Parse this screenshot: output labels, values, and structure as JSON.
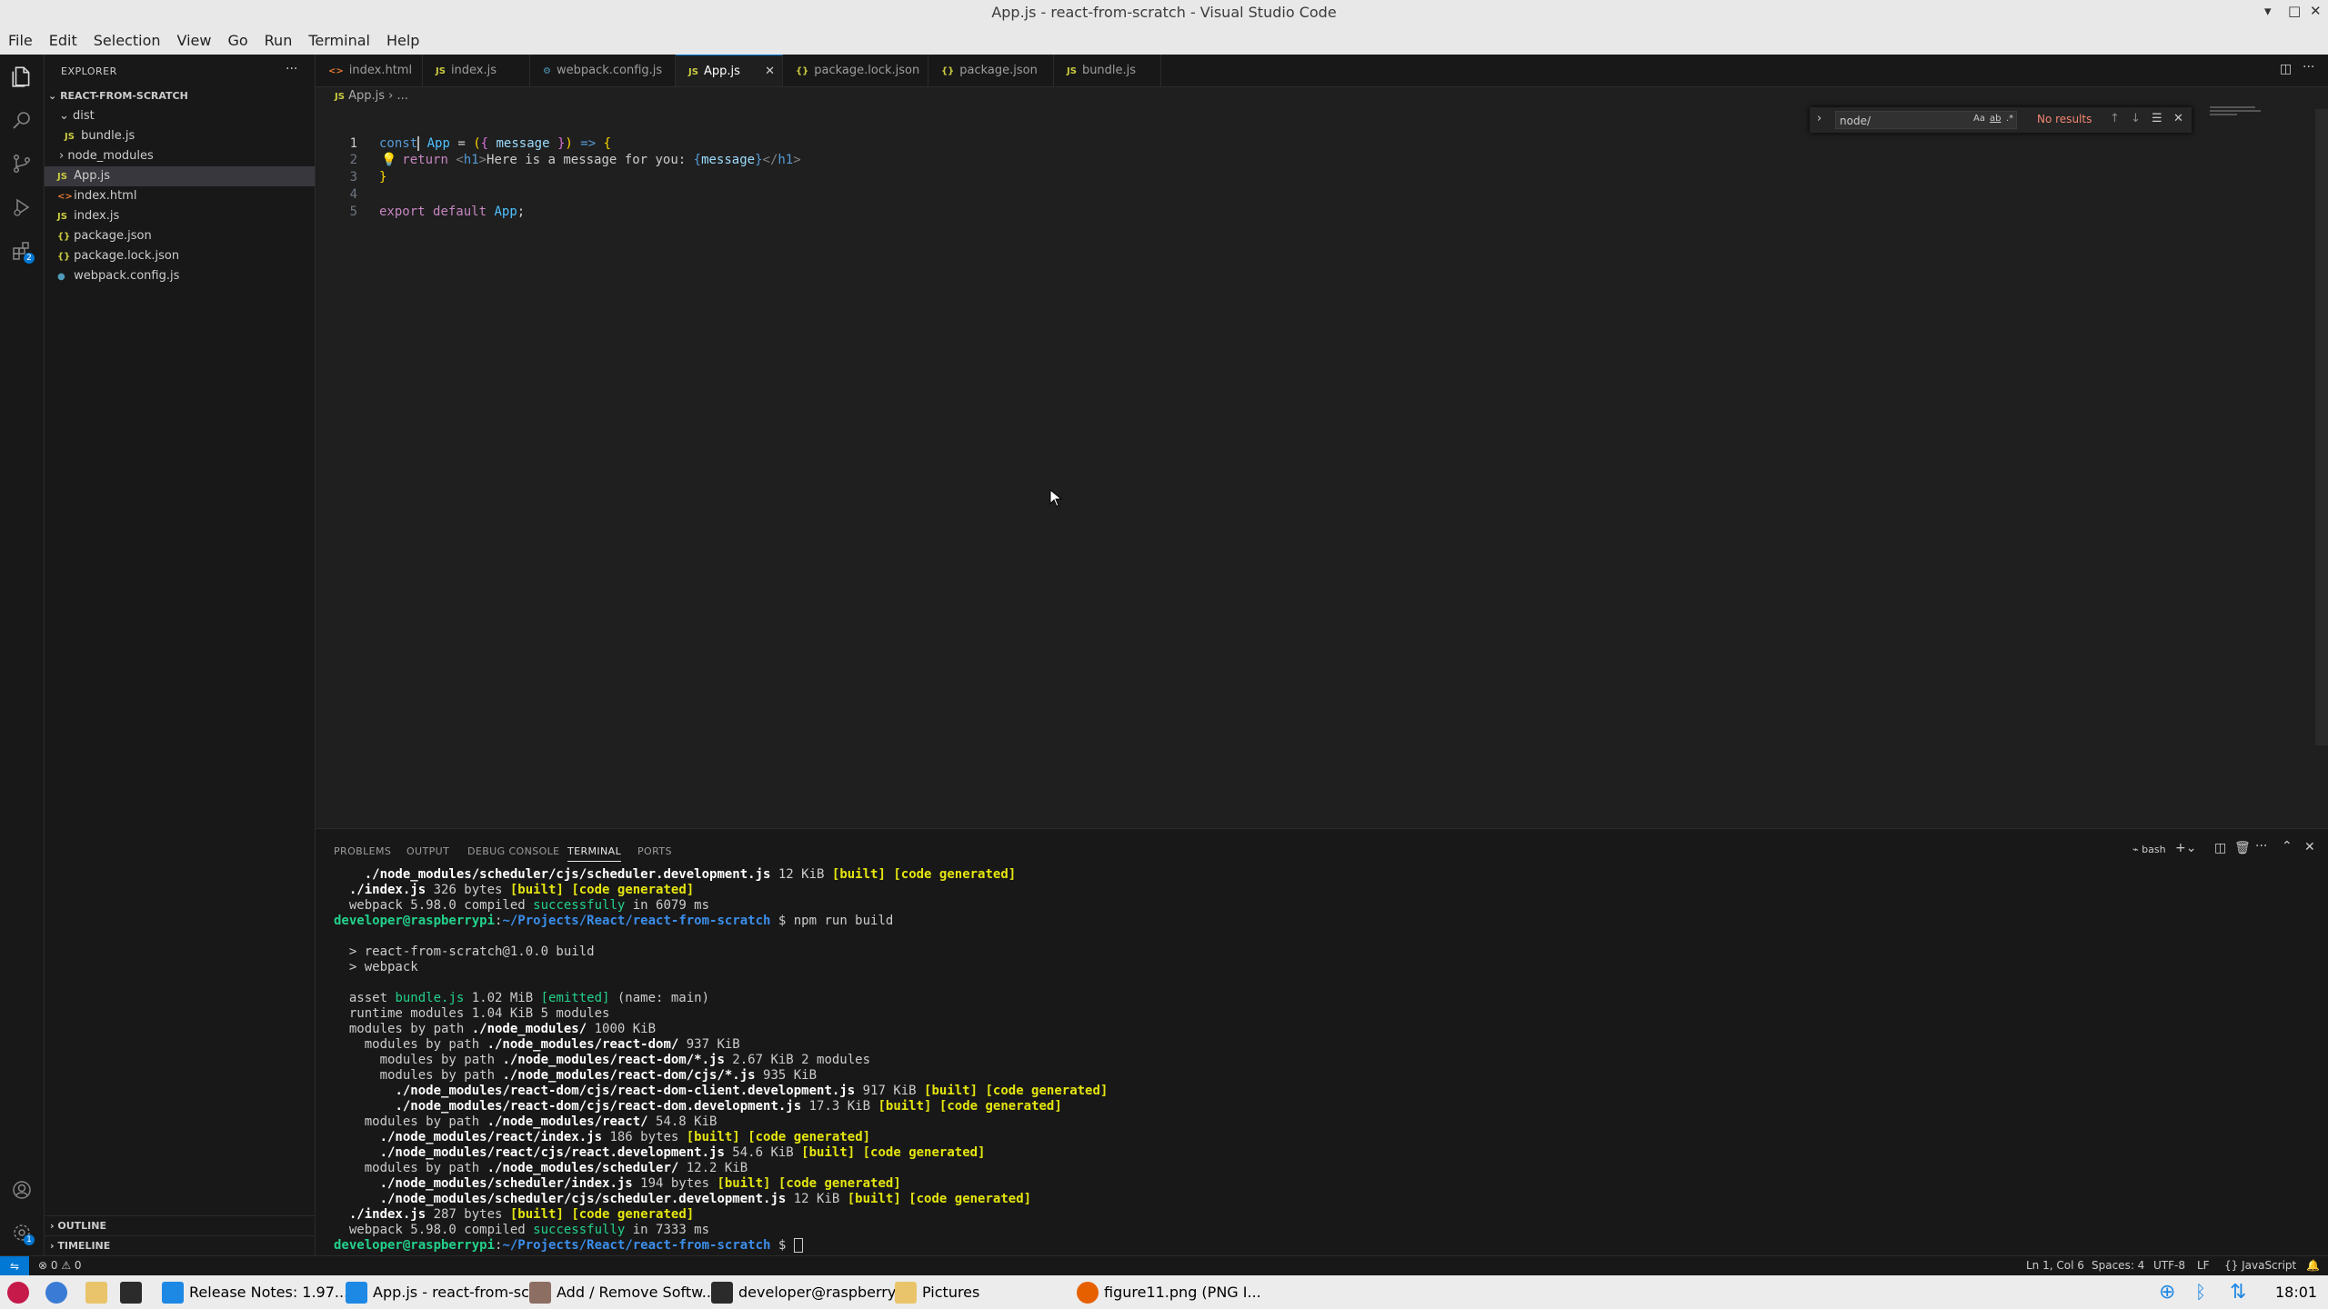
{
  "window": {
    "title": "App.js - react-from-scratch - Visual Studio Code"
  },
  "menu": [
    "File",
    "Edit",
    "Selection",
    "View",
    "Go",
    "Run",
    "Terminal",
    "Help"
  ],
  "explorer": {
    "header": "EXPLORER",
    "project": "REACT-FROM-SCRATCH",
    "items": [
      {
        "label": "dist",
        "type": "folder-open",
        "icon": "chevron-down-icon"
      },
      {
        "label": "bundle.js",
        "type": "js",
        "icon": "JS"
      },
      {
        "label": "node_modules",
        "type": "folder",
        "icon": "chevron-right-icon"
      },
      {
        "label": "App.js",
        "type": "js",
        "icon": "JS"
      },
      {
        "label": "index.html",
        "type": "html",
        "icon": "<>"
      },
      {
        "label": "index.js",
        "type": "js",
        "icon": "JS"
      },
      {
        "label": "package.json",
        "type": "json",
        "icon": "{}"
      },
      {
        "label": "package.lock.json",
        "type": "json",
        "icon": "{}"
      },
      {
        "label": "webpack.config.js",
        "type": "config",
        "icon": "gear"
      }
    ],
    "outline": "OUTLINE",
    "timeline": "TIMELINE"
  },
  "activity": {
    "extensions_badge": "2",
    "settings_badge": "1"
  },
  "tabs": [
    {
      "label": "index.html",
      "icon": "<>"
    },
    {
      "label": "index.js",
      "icon": "JS"
    },
    {
      "label": "webpack.config.js",
      "icon": "⚙"
    },
    {
      "label": "App.js",
      "icon": "JS"
    },
    {
      "label": "package.lock.json",
      "icon": "{}"
    },
    {
      "label": "package.json",
      "icon": "{}"
    },
    {
      "label": "bundle.js",
      "icon": "JS"
    }
  ],
  "breadcrumb": {
    "file": "App.js",
    "rest": "..."
  },
  "find": {
    "query": "node/",
    "result": "No results",
    "opt_case": "Aa",
    "opt_word": "ab",
    "opt_regex": ".*"
  },
  "editor": {
    "line_numbers": [
      "1",
      "2",
      "3",
      "4",
      "5"
    ],
    "lines": [
      "const App = ({ message }) => {",
      "  return <h1>Here is a message for you: {message}</h1>",
      "}",
      "",
      "export default App;"
    ]
  },
  "panel": {
    "tabs": [
      "PROBLEMS",
      "OUTPUT",
      "DEBUG CONSOLE",
      "TERMINAL",
      "PORTS"
    ],
    "shell": "bash",
    "terminal": [
      "    ./node_modules/scheduler/cjs/scheduler.development.js 12 KiB [built] [code generated]",
      "  ./index.js 326 bytes [built] [code generated]",
      "  webpack 5.98.0 compiled successfully in 6079 ms",
      "developer@raspberrypi:~/Projects/React/react-from-scratch $ npm run build",
      "",
      "  > react-from-scratch@1.0.0 build",
      "  > webpack",
      "",
      "  asset bundle.js 1.02 MiB [emitted] (name: main)",
      "  runtime modules 1.04 KiB 5 modules",
      "  modules by path ./node_modules/ 1000 KiB",
      "    modules by path ./node_modules/react-dom/ 937 KiB",
      "      modules by path ./node_modules/react-dom/*.js 2.67 KiB 2 modules",
      "      modules by path ./node_modules/react-dom/cjs/*.js 935 KiB",
      "        ./node_modules/react-dom/cjs/react-dom-client.development.js 917 KiB [built] [code generated]",
      "        ./node_modules/react-dom/cjs/react-dom.development.js 17.3 KiB [built] [code generated]",
      "    modules by path ./node_modules/react/ 54.8 KiB",
      "      ./node_modules/react/index.js 186 bytes [built] [code generated]",
      "      ./node_modules/react/cjs/react.development.js 54.6 KiB [built] [code generated]",
      "    modules by path ./node_modules/scheduler/ 12.2 KiB",
      "      ./node_modules/scheduler/index.js 194 bytes [built] [code generated]",
      "      ./node_modules/scheduler/cjs/scheduler.development.js 12 KiB [built] [code generated]",
      "  ./index.js 287 bytes [built] [code generated]",
      "  webpack 5.98.0 compiled successfully in 7333 ms",
      "developer@raspberrypi:~/Projects/React/react-from-scratch $ "
    ]
  },
  "status": {
    "problems": "0",
    "warnings": "0",
    "position": "Ln 1, Col 6",
    "spaces": "Spaces: 4",
    "encoding": "UTF-8",
    "eol": "LF",
    "language": "JavaScript"
  },
  "taskbar": {
    "items": [
      "Release Notes: 1.97...",
      "App.js - react-from-sc...",
      "Add / Remove Softw...",
      "developer@raspberry...",
      "Pictures",
      "figure11.png (PNG I..."
    ],
    "time": "18:01"
  },
  "colors": {
    "accent": "#0078d4",
    "background": "#1f1f1f",
    "sidebar": "#181818"
  }
}
